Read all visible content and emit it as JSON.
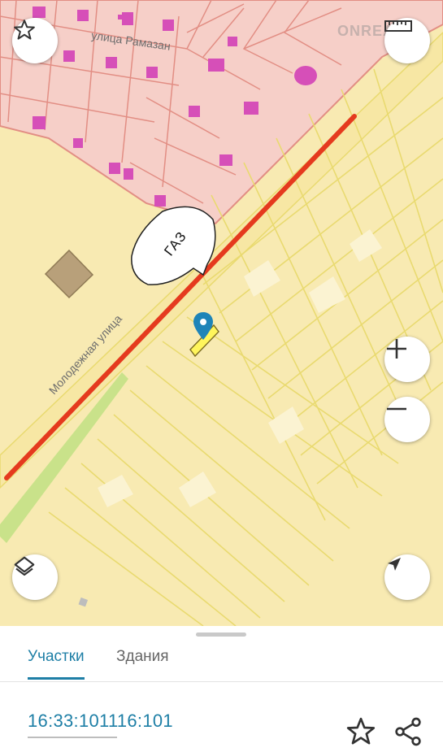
{
  "map": {
    "watermark": "ONREAL",
    "overlay_label": "ГАЗ",
    "streets": {
      "molodezhnaya": "Молодежная улица",
      "ramazan": "улица Рамазан"
    },
    "colors": {
      "land": "#f8eab2",
      "parcel_outline": "#e9da70",
      "residential_area": "#f6cfc8",
      "residential_outline": "#e28e84",
      "building": "#d64fb8",
      "highway": "#f7e7a4",
      "gas_line": "#e53a1e",
      "green_strip": "#c9e28a",
      "selected_parcel": "#fff55c",
      "pin": "#1e84b8"
    },
    "controls": {
      "favorite": "star-icon",
      "ruler": "ruler-icon",
      "zoom_in": "plus-icon",
      "zoom_out": "minus-icon",
      "layers": "layers-icon",
      "locate": "navigation-arrow-icon"
    }
  },
  "panel": {
    "tabs": [
      {
        "label": "Участки",
        "active": true
      },
      {
        "label": "Здания",
        "active": false
      }
    ],
    "cadastral_number": "16:33:101116:101",
    "actions": {
      "favorite": "star-outline-icon",
      "share": "share-icon"
    }
  }
}
